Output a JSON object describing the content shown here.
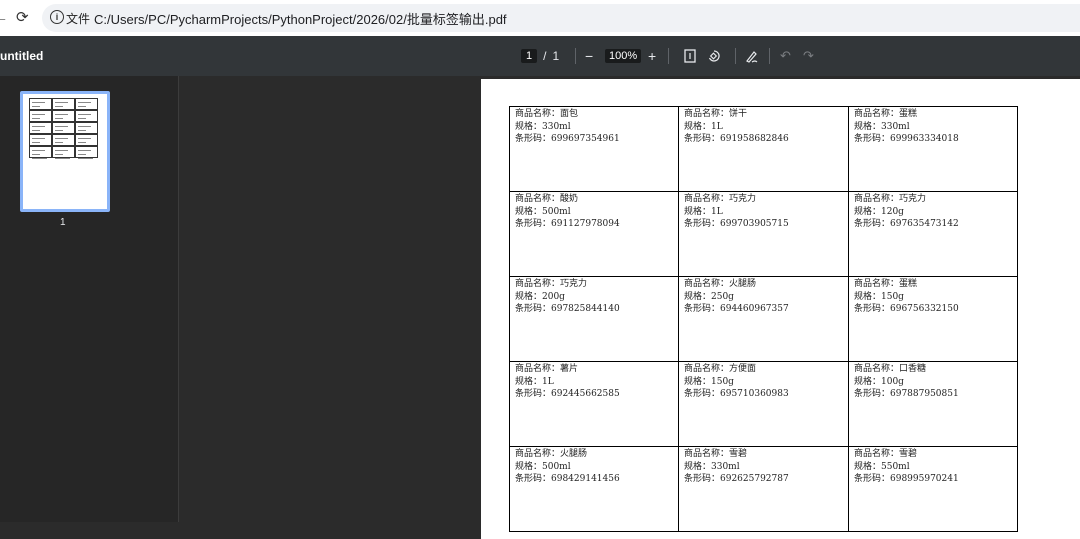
{
  "browser": {
    "file_label": "文件",
    "url": "C:/Users/PC/PycharmProjects/PythonProject/2026/02/批量标签输出.pdf"
  },
  "toolbar": {
    "title": "untitled",
    "current_page": "1",
    "separator": "/",
    "total_pages": "1",
    "zoom": "100%",
    "zoom_out": "−",
    "zoom_in": "+"
  },
  "sidebar": {
    "thumb_label": "1"
  },
  "labels": [
    {
      "name": "商品名称：面包",
      "spec": "规格：330ml",
      "barcode": "条形码：699697354961"
    },
    {
      "name": "商品名称：饼干",
      "spec": "规格：1L",
      "barcode": "条形码：691958682846"
    },
    {
      "name": "商品名称：蛋糕",
      "spec": "规格：330ml",
      "barcode": "条形码：699963334018"
    },
    {
      "name": "商品名称：酸奶",
      "spec": "规格：500ml",
      "barcode": "条形码：691127978094"
    },
    {
      "name": "商品名称：巧克力",
      "spec": "规格：1L",
      "barcode": "条形码：699703905715"
    },
    {
      "name": "商品名称：巧克力",
      "spec": "规格：120g",
      "barcode": "条形码：697635473142"
    },
    {
      "name": "商品名称：巧克力",
      "spec": "规格：200g",
      "barcode": "条形码：697825844140"
    },
    {
      "name": "商品名称：火腿肠",
      "spec": "规格：250g",
      "barcode": "条形码：694460967357"
    },
    {
      "name": "商品名称：蛋糕",
      "spec": "规格：150g",
      "barcode": "条形码：696756332150"
    },
    {
      "name": "商品名称：薯片",
      "spec": "规格：1L",
      "barcode": "条形码：692445662585"
    },
    {
      "name": "商品名称：方便面",
      "spec": "规格：150g",
      "barcode": "条形码：695710360983"
    },
    {
      "name": "商品名称：口香糖",
      "spec": "规格：100g",
      "barcode": "条形码：697887950851"
    },
    {
      "name": "商品名称：火腿肠",
      "spec": "规格：500ml",
      "barcode": "条形码：698429141456"
    },
    {
      "name": "商品名称：雪碧",
      "spec": "规格：330ml",
      "barcode": "条形码：692625792787"
    },
    {
      "name": "商品名称：雪碧",
      "spec": "规格：550ml",
      "barcode": "条形码：698995970241"
    }
  ]
}
